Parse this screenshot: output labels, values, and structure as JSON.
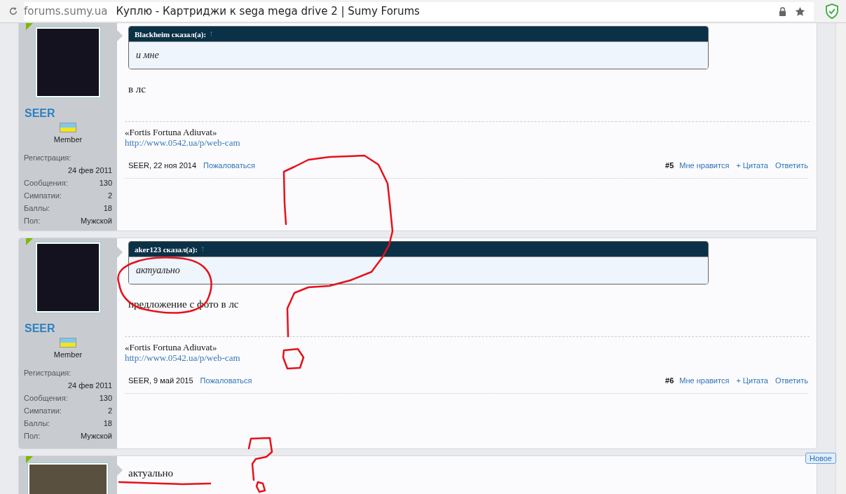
{
  "browser": {
    "domain": "forums.sumy.ua",
    "title": "Куплю - Картриджи к sega mega drive 2 | Sumy Forums"
  },
  "posts": [
    {
      "kind": "full",
      "author": "SEER",
      "role": "Member",
      "stats": [
        {
          "label": "Регистрация:",
          "value": "24 фев 2011"
        },
        {
          "label": "Сообщения:",
          "value": "130"
        },
        {
          "label": "Симпатии:",
          "value": "2"
        },
        {
          "label": "Баллы:",
          "value": "18"
        },
        {
          "label": "Пол:",
          "value": "Мужской"
        }
      ],
      "quote": {
        "author": "Blackheim сказал(а):",
        "arrow": "↑",
        "text": "и мне"
      },
      "message": "в лс",
      "signature": {
        "motto": "«Fortis Fortuna Adiuvat»",
        "link": "http://www.0542.ua/p/web-cam"
      },
      "footer": {
        "author_date": "SEER, 22 ноя 2014",
        "report": "Пожаловаться",
        "number": "#5",
        "like": "Мне нравится",
        "quote": "+ Цитата",
        "reply": "Ответить"
      }
    },
    {
      "kind": "full",
      "author": "SEER",
      "role": "Member",
      "stats": [
        {
          "label": "Регистрация:",
          "value": "24 фев 2011"
        },
        {
          "label": "Сообщения:",
          "value": "130"
        },
        {
          "label": "Симпатии:",
          "value": "2"
        },
        {
          "label": "Баллы:",
          "value": "18"
        },
        {
          "label": "Пол:",
          "value": "Мужской"
        }
      ],
      "quote": {
        "author": "aker123 сказал(а):",
        "arrow": "↑",
        "text": "актуально"
      },
      "message": "предложение с фото в лс",
      "signature": {
        "motto": "«Fortis Fortuna Adiuvat»",
        "link": "http://www.0542.ua/p/web-cam"
      },
      "footer": {
        "author_date": "SEER, 9 май 2015",
        "report": "Пожаловаться",
        "number": "#6",
        "like": "Мне нравится",
        "quote": "+ Цитата",
        "reply": "Ответить"
      }
    },
    {
      "kind": "partial",
      "message": "актуально",
      "badge": "Новое"
    }
  ]
}
